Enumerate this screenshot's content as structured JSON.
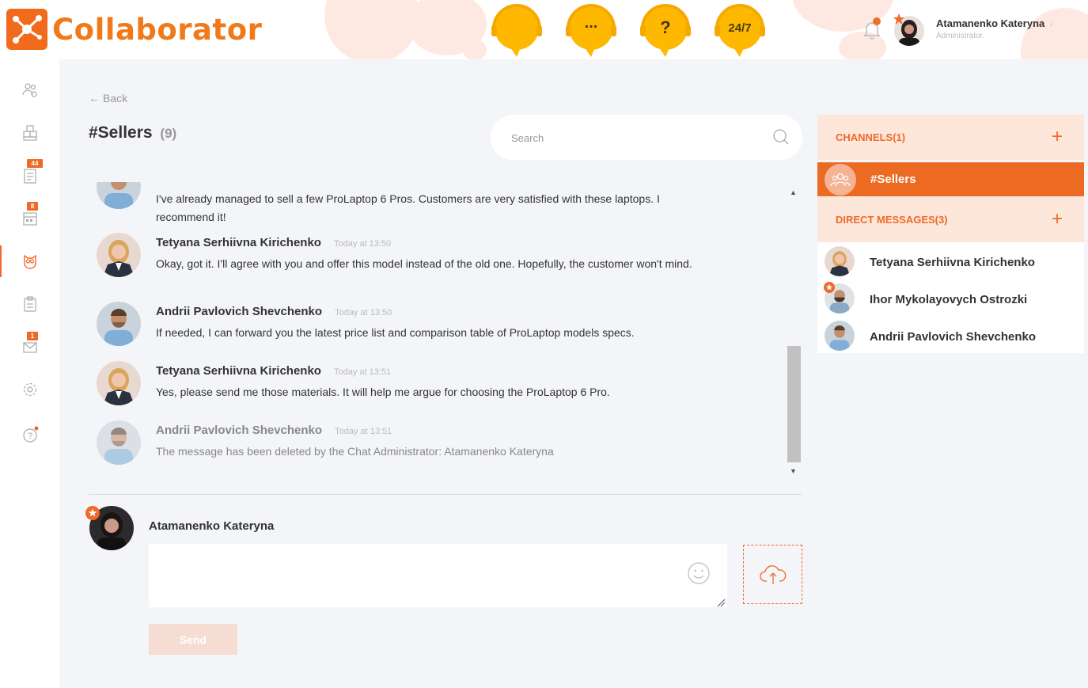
{
  "brand": {
    "name": "Collaborator",
    "accent": "#ef6a28"
  },
  "support_buttons": [
    {
      "label": "",
      "icon": "headset-chat-icon"
    },
    {
      "label": "...",
      "icon": "chat-dots-icon"
    },
    {
      "label": "?",
      "icon": "help-question-icon"
    },
    {
      "label": "24/7",
      "icon": "support-247-icon"
    }
  ],
  "user": {
    "name": "Atamanenko Kateryna",
    "role": "Administrator."
  },
  "sidebar": {
    "badges": {
      "tasks": "44",
      "projects": "8",
      "mail": "1"
    }
  },
  "page": {
    "back_label": "Back",
    "title": "#Sellers",
    "member_count": "(9)"
  },
  "search": {
    "placeholder": "Search"
  },
  "messages": [
    {
      "author": "",
      "time": "",
      "text": "I've already managed to sell a few ProLaptop 6 Pros. Customers are very satisfied with these laptops. I recommend it!"
    },
    {
      "author": "Tetyana Serhiivna Kirichenko",
      "time": "Today at 13:50",
      "text": "Okay, got it. I'll agree with you and offer this model instead of the old one. Hopefully, the customer won't mind."
    },
    {
      "author": "Andrii Pavlovich Shevchenko",
      "time": "Today at 13:50",
      "text": "If needed, I can forward you the latest price list and comparison table of ProLaptop models specs."
    },
    {
      "author": "Tetyana Serhiivna Kirichenko",
      "time": "Today at 13:51",
      "text": "Yes, please send me those materials. It will help me argue for choosing the ProLaptop 6 Pro."
    },
    {
      "author": "Andrii Pavlovich Shevchenko",
      "time": "Today at 13:51",
      "text": "The message has been deleted by the Chat Administrator: Atamanenko Kateryna"
    }
  ],
  "composer": {
    "author": "Atamanenko Kateryna",
    "text": "",
    "send_label": "Send"
  },
  "channels": {
    "header": "CHANNELS(1)",
    "items": [
      {
        "label": "#Sellers"
      }
    ]
  },
  "direct_messages": {
    "header": "DIRECT MESSAGES(3)",
    "items": [
      {
        "name": "Tetyana Serhiivna Kirichenko"
      },
      {
        "name": "Ihor Mykolayovych Ostrozki"
      },
      {
        "name": "Andrii Pavlovich Shevchenko"
      }
    ]
  }
}
